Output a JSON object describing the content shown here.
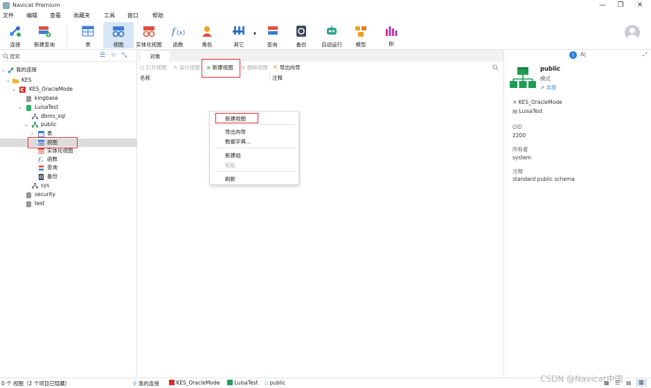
{
  "window": {
    "title": "Navicat Premium",
    "controls": [
      "—",
      "❐",
      "✕"
    ]
  },
  "menu": [
    "文件",
    "编辑",
    "查看",
    "收藏夹",
    "工具",
    "窗口",
    "帮助"
  ],
  "toolbar": [
    {
      "label": "连接",
      "icon": "connect-icon"
    },
    {
      "label": "新建查询",
      "icon": "new-query-icon"
    },
    {
      "label": "表",
      "icon": "table-icon"
    },
    {
      "label": "视图",
      "icon": "view-icon"
    },
    {
      "label": "实体化视图",
      "icon": "materialized-view-icon"
    },
    {
      "label": "函数",
      "icon": "function-icon"
    },
    {
      "label": "角色",
      "icon": "role-icon"
    },
    {
      "label": "其它",
      "icon": "other-icon"
    },
    {
      "label": "查询",
      "icon": "query-icon"
    },
    {
      "label": "备份",
      "icon": "backup-icon"
    },
    {
      "label": "自动运行",
      "icon": "automation-icon"
    },
    {
      "label": "模型",
      "icon": "model-icon"
    },
    {
      "label": "BI",
      "icon": "bi-icon"
    }
  ],
  "sidebar": {
    "search_placeholder": "搜索",
    "tree": [
      {
        "label": "我的连接"
      },
      {
        "label": "KES"
      },
      {
        "label": "KES_OracleMode"
      },
      {
        "label": "kingbase"
      },
      {
        "label": "LuisaTest"
      },
      {
        "label": "dbms_sql"
      },
      {
        "label": "public"
      },
      {
        "label": "表"
      },
      {
        "label": "视图"
      },
      {
        "label": "实体化视图"
      },
      {
        "label": "函数"
      },
      {
        "label": "查询"
      },
      {
        "label": "备份"
      },
      {
        "label": "sys"
      },
      {
        "label": "security"
      },
      {
        "label": "test"
      }
    ]
  },
  "main": {
    "tab_label": "对象",
    "actions": {
      "open_view": "打开视图",
      "design_view": "设计视图",
      "new_view": "新建视图",
      "delete_view": "删除视图",
      "export_wizard": "导出向导"
    },
    "columns": {
      "name": "名称",
      "comment": "注释"
    }
  },
  "context_menu": {
    "items": [
      "新建视图",
      "导出向导",
      "数据字典...",
      "新建组",
      "粘贴",
      "刷新"
    ]
  },
  "info_panel": {
    "name": "public",
    "type": "模式",
    "share": "共享",
    "connection": "KES_OracleMode",
    "database": "LuisaTest",
    "oid_label": "OID",
    "oid_value": "2200",
    "owner_label": "所有者",
    "owner_value": "system",
    "comment_label": "注释",
    "comment_value": "standard public schema"
  },
  "status": {
    "count": "0 个 视图（2 个项目已隐藏）",
    "crumbs": [
      "我的连接",
      "KES_OracleMode",
      "LuisaTest",
      "public"
    ],
    "watermark": "CSDN @Navicat中国"
  },
  "colors": {
    "highlight": "#e8262b",
    "active_tool": "#d6e6f6"
  }
}
